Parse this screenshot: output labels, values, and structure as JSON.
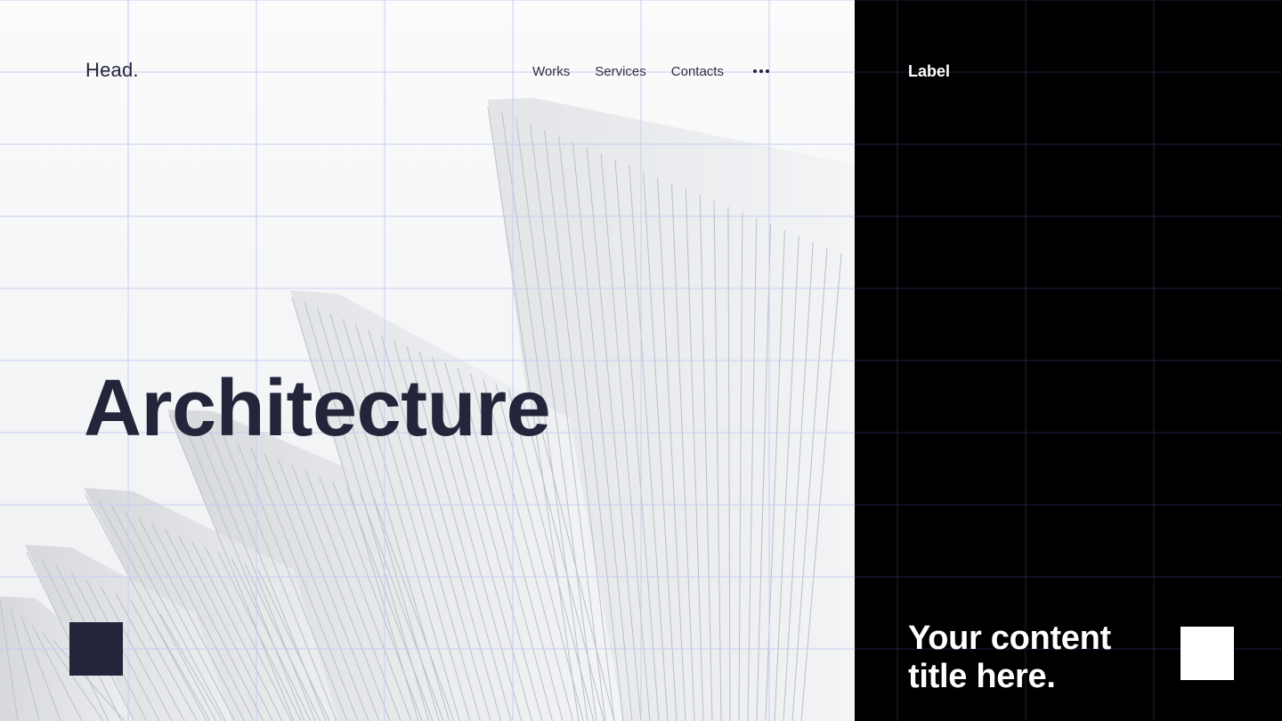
{
  "header": {
    "logo": "Head.",
    "nav": [
      {
        "label": "Works"
      },
      {
        "label": "Services"
      },
      {
        "label": "Contacts"
      }
    ],
    "more_icon": "more-horizontal-icon"
  },
  "hero": {
    "title": "Architecture",
    "image": "architecture-white-fins-photo"
  },
  "side": {
    "label": "Label",
    "content_title": "Your content title here."
  },
  "colors": {
    "ink": "#23263a",
    "panel": "#000000",
    "grid_light": "#c9cdf0",
    "grid_dark": "#1e2140",
    "square_light": "#ffffff"
  }
}
